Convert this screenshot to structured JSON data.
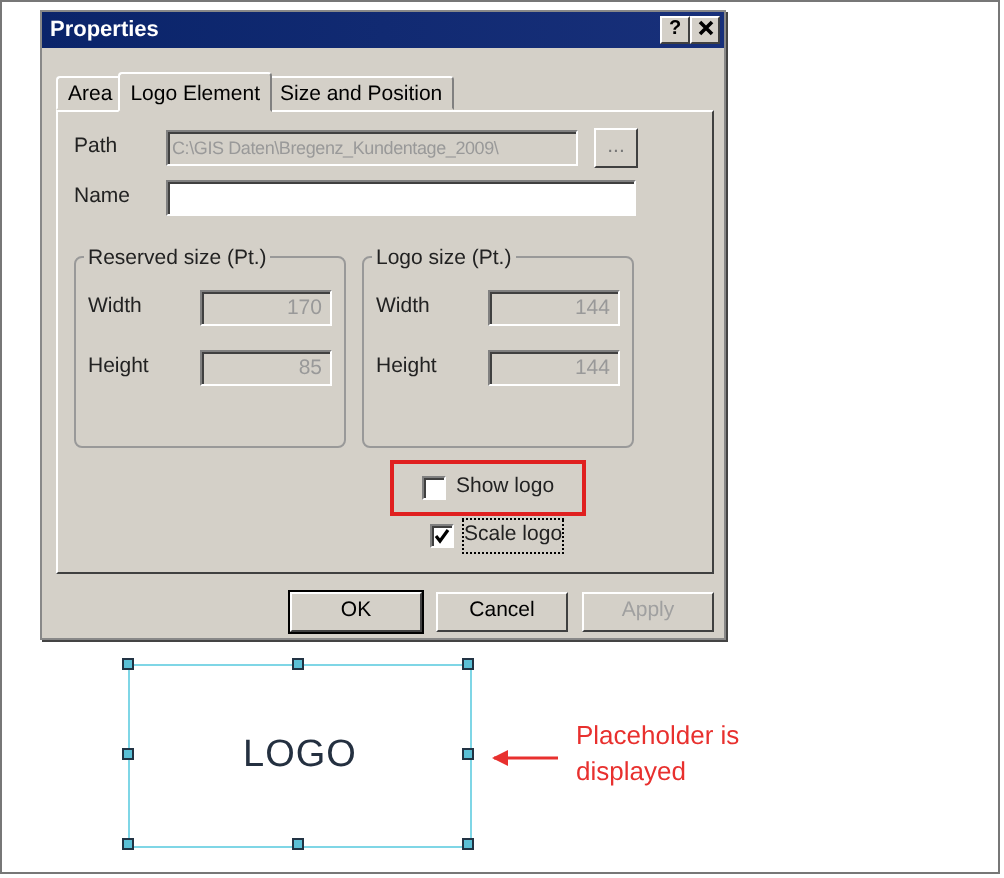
{
  "window": {
    "title": "Properties",
    "help_button": "?"
  },
  "tabs": [
    {
      "label": "Area",
      "selected": false
    },
    {
      "label": "Logo Element",
      "selected": true
    },
    {
      "label": "Size and Position",
      "selected": false
    }
  ],
  "path": {
    "label": "Path",
    "value": "C:\\GIS Daten\\Bregenz_Kundentage_2009\\",
    "browse_button": "..."
  },
  "name": {
    "label": "Name"
  },
  "groups": [
    {
      "title": "Reserved size (Pt.)",
      "fields": [
        {
          "label": "Width",
          "value": "170"
        },
        {
          "label": "Height",
          "value": "85"
        }
      ]
    },
    {
      "title": "Logo size (Pt.)",
      "fields": [
        {
          "label": "Width",
          "value": "144"
        },
        {
          "label": "Height",
          "value": "144"
        }
      ]
    }
  ],
  "checkboxes": [
    {
      "label": "Show logo",
      "checked": false,
      "highlighted": true,
      "focused": false
    },
    {
      "label": "Scale logo",
      "checked": true,
      "highlighted": false,
      "focused": true
    }
  ],
  "buttons": [
    {
      "label": "OK",
      "disabled": false,
      "default": true
    },
    {
      "label": "Cancel",
      "disabled": false,
      "default": false
    },
    {
      "label": "Apply",
      "disabled": true,
      "default": false
    }
  ],
  "canvas": {
    "logo_text": "LOGO",
    "callout": "Placeholder is displayed"
  }
}
